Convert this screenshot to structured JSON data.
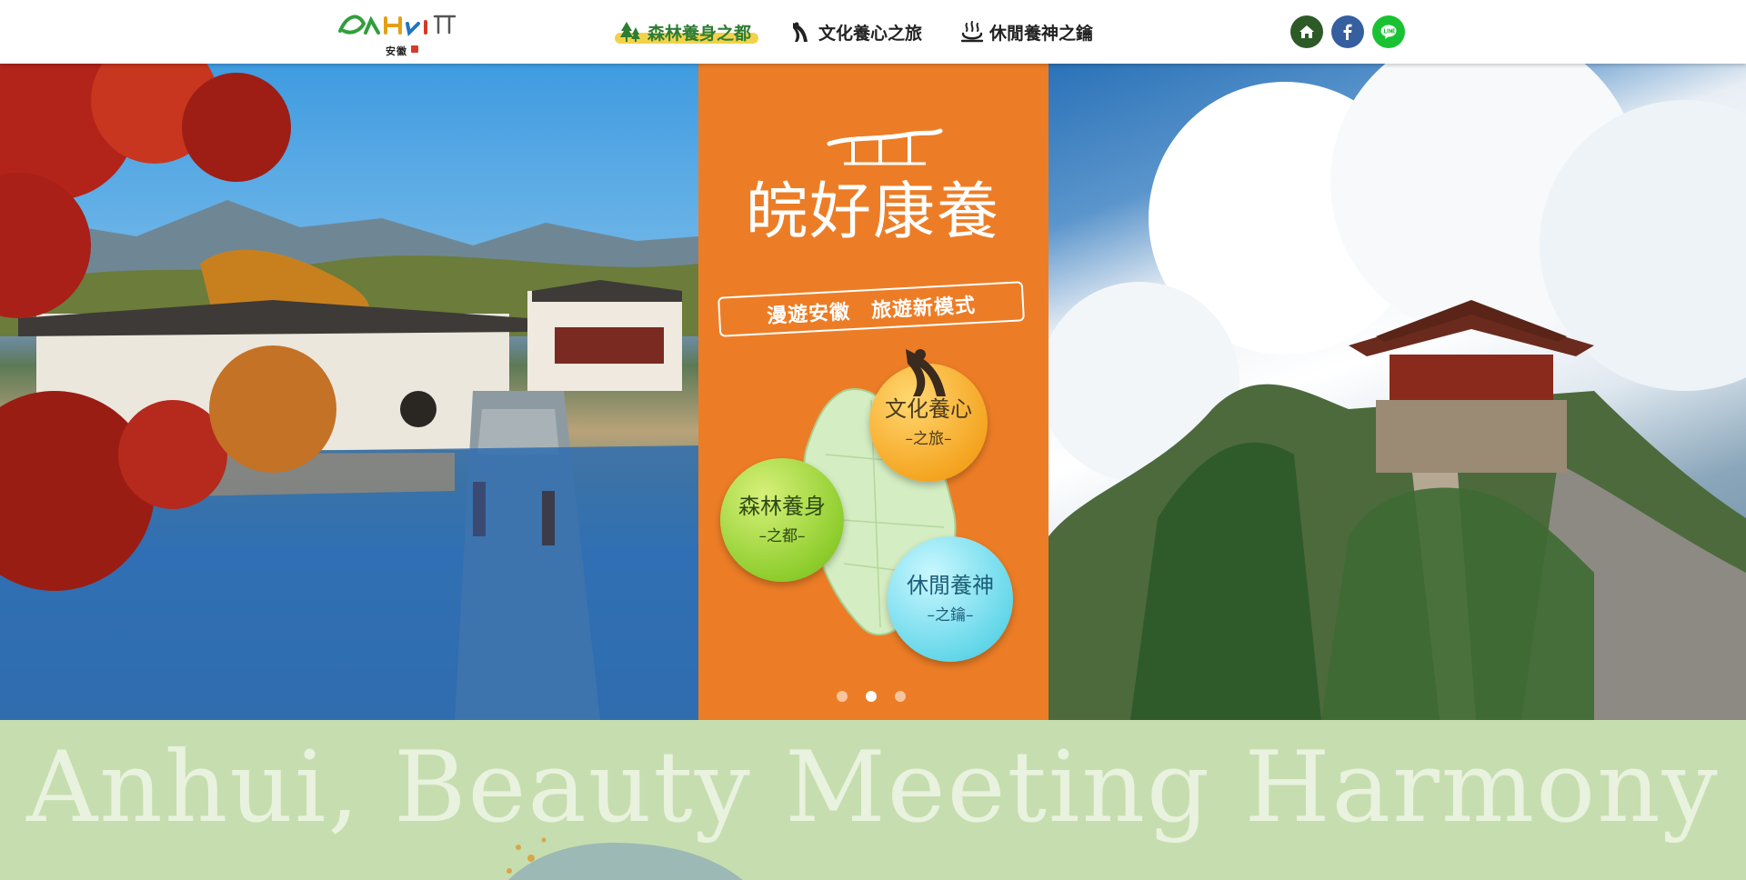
{
  "header": {
    "logo": {
      "wordmark": "AnHui",
      "sub": "安徽"
    },
    "nav": [
      {
        "label": "森林養身之都",
        "icon": "forest-tree-icon",
        "active": true
      },
      {
        "label": "文化養心之旅",
        "icon": "dancer-icon",
        "active": false
      },
      {
        "label": "休閒養神之鑰",
        "icon": "hot-spring-icon",
        "active": false
      }
    ],
    "social": [
      {
        "name": "home-icon",
        "color": "#2d5a27"
      },
      {
        "name": "facebook-icon",
        "color": "#355f9e"
      },
      {
        "name": "line-icon",
        "color": "#19c232"
      }
    ]
  },
  "hero": {
    "title": "皖好康養",
    "banner": "漫遊安徽　旅遊新模式",
    "bubbles": {
      "culture": {
        "main": "文化養心",
        "sub": "–之旅–"
      },
      "forest": {
        "main": "森林養身",
        "sub": "–之都–"
      },
      "leisure": {
        "main": "休閒養神",
        "sub": "–之鑰–"
      }
    },
    "center_color": "#ec7d26",
    "carousel": {
      "count": 3,
      "active_index": 1
    }
  },
  "footer": {
    "tagline": "Anhui, Beauty Meeting Harmony",
    "color": "#c6deaf"
  }
}
